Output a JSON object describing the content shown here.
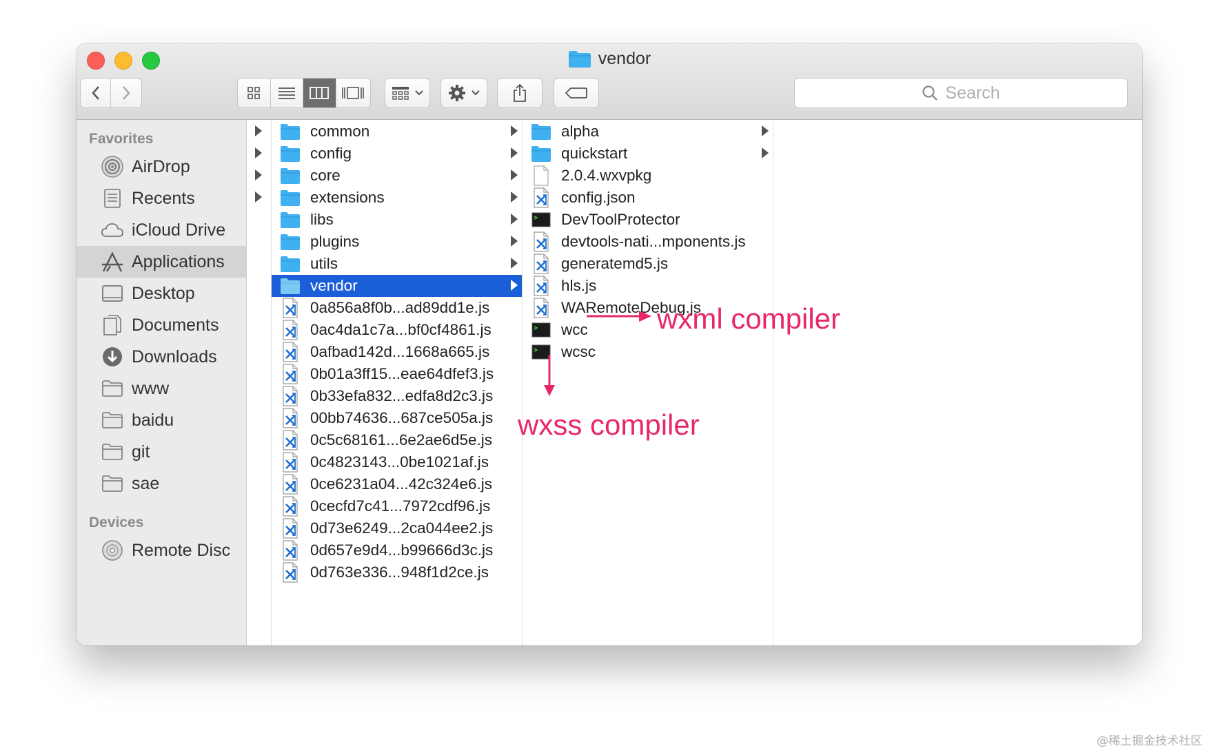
{
  "window": {
    "title": "vendor"
  },
  "search": {
    "placeholder": "Search"
  },
  "sidebar": {
    "favorites_label": "Favorites",
    "favorites": [
      {
        "label": "AirDrop",
        "icon": "airdrop-icon"
      },
      {
        "label": "Recents",
        "icon": "recents-icon"
      },
      {
        "label": "iCloud Drive",
        "icon": "cloud-icon"
      },
      {
        "label": "Applications",
        "icon": "applications-icon",
        "selected": true
      },
      {
        "label": "Desktop",
        "icon": "desktop-icon"
      },
      {
        "label": "Documents",
        "icon": "documents-icon"
      },
      {
        "label": "Downloads",
        "icon": "downloads-icon"
      },
      {
        "label": "www",
        "icon": "folder-icon"
      },
      {
        "label": "baidu",
        "icon": "folder-icon"
      },
      {
        "label": "git",
        "icon": "folder-icon"
      },
      {
        "label": "sae",
        "icon": "folder-icon"
      }
    ],
    "devices_label": "Devices",
    "devices": [
      {
        "label": "Remote Disc",
        "icon": "disc-icon"
      }
    ]
  },
  "column2": [
    {
      "name": "common",
      "type": "folder"
    },
    {
      "name": "config",
      "type": "folder"
    },
    {
      "name": "core",
      "type": "folder"
    },
    {
      "name": "extensions",
      "type": "folder"
    },
    {
      "name": "libs",
      "type": "folder"
    },
    {
      "name": "plugins",
      "type": "folder"
    },
    {
      "name": "utils",
      "type": "folder"
    },
    {
      "name": "vendor",
      "type": "folder",
      "selected": true
    },
    {
      "name": "0a856a8f0b...ad89dd1e.js",
      "type": "js"
    },
    {
      "name": "0ac4da1c7a...bf0cf4861.js",
      "type": "js"
    },
    {
      "name": "0afbad142d...1668a665.js",
      "type": "js"
    },
    {
      "name": "0b01a3ff15...eae64dfef3.js",
      "type": "js"
    },
    {
      "name": "0b33efa832...edfa8d2c3.js",
      "type": "js"
    },
    {
      "name": "00bb74636...687ce505a.js",
      "type": "js"
    },
    {
      "name": "0c5c68161...6e2ae6d5e.js",
      "type": "js"
    },
    {
      "name": "0c4823143...0be1021af.js",
      "type": "js"
    },
    {
      "name": "0ce6231a04...42c324e6.js",
      "type": "js"
    },
    {
      "name": "0cecfd7c41...7972cdf96.js",
      "type": "js"
    },
    {
      "name": "0d73e6249...2ca044ee2.js",
      "type": "js"
    },
    {
      "name": "0d657e9d4...b99666d3c.js",
      "type": "js"
    },
    {
      "name": "0d763e336...948f1d2ce.js",
      "type": "js"
    }
  ],
  "column3": [
    {
      "name": "alpha",
      "type": "folder"
    },
    {
      "name": "quickstart",
      "type": "folder"
    },
    {
      "name": "2.0.4.wxvpkg",
      "type": "doc"
    },
    {
      "name": "config.json",
      "type": "js"
    },
    {
      "name": "DevToolProtector",
      "type": "exec"
    },
    {
      "name": "devtools-nati...mponents.js",
      "type": "js"
    },
    {
      "name": "generatemd5.js",
      "type": "js"
    },
    {
      "name": "hls.js",
      "type": "js"
    },
    {
      "name": "WARemoteDebug.js",
      "type": "js"
    },
    {
      "name": "wcc",
      "type": "exec"
    },
    {
      "name": "wcsc",
      "type": "exec"
    }
  ],
  "annotations": {
    "wcc": "wxml compiler",
    "wcsc": "wxss compiler"
  },
  "watermark": "@稀土掘金技术社区",
  "colors": {
    "selection": "#1b5fd8",
    "folder": "#3fb0f0",
    "annotation": "#e8276a"
  }
}
